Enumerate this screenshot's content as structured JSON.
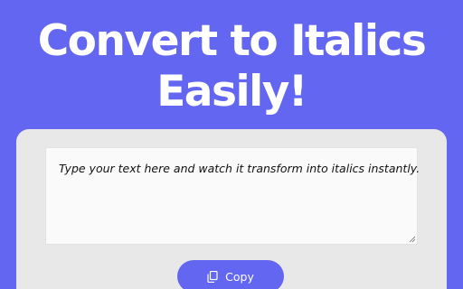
{
  "header": {
    "title_line1": "Convert to Italics",
    "title_line2": "Easily!"
  },
  "editor": {
    "text": "Type your text here and watch it transform into italics instantly."
  },
  "actions": {
    "copy_label": "Copy",
    "copy_icon": "copy-icon"
  },
  "colors": {
    "accent": "#6366f1",
    "card_background": "#e8e8e8",
    "editor_background": "#fafafa",
    "heading_text": "#ffffff"
  }
}
